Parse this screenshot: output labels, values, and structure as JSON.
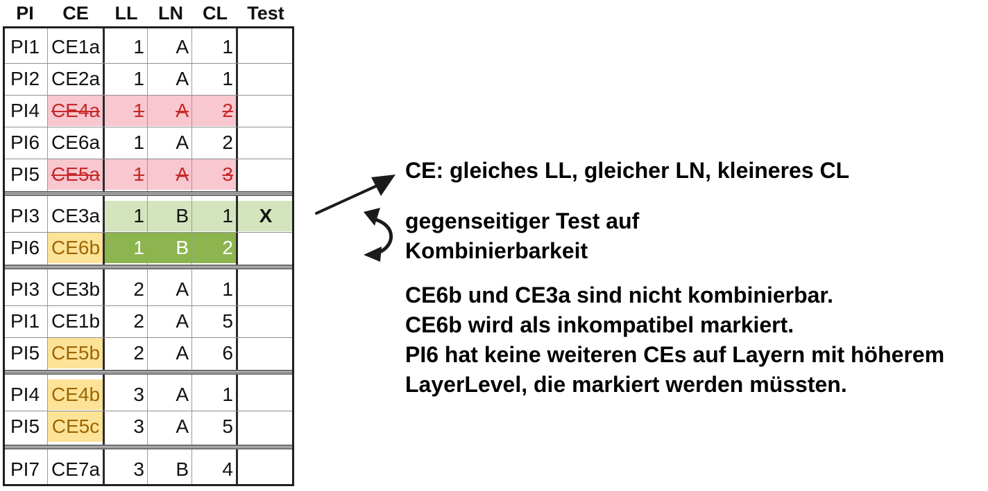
{
  "columns": [
    "PI",
    "CE",
    "LL",
    "LN",
    "CL",
    "Test"
  ],
  "rows": [
    {
      "pi": "PI1",
      "ce": "CE1a",
      "ll": "1",
      "ln": "A",
      "cl": "1",
      "test": "",
      "style": "normal"
    },
    {
      "pi": "PI2",
      "ce": "CE2a",
      "ll": "1",
      "ln": "A",
      "cl": "1",
      "test": "",
      "style": "normal"
    },
    {
      "pi": "PI4",
      "ce": "CE4a",
      "ll": "1",
      "ln": "A",
      "cl": "2",
      "test": "",
      "style": "struck"
    },
    {
      "pi": "PI6",
      "ce": "CE6a",
      "ll": "1",
      "ln": "A",
      "cl": "2",
      "test": "",
      "style": "normal"
    },
    {
      "pi": "PI5",
      "ce": "CE5a",
      "ll": "1",
      "ln": "A",
      "cl": "3",
      "test": "",
      "style": "struck"
    },
    {
      "pi": "PI3",
      "ce": "CE3a",
      "ll": "1",
      "ln": "B",
      "cl": "1",
      "test": "X",
      "style": "tested"
    },
    {
      "pi": "PI6",
      "ce": "CE6b",
      "ll": "1",
      "ln": "B",
      "cl": "2",
      "test": "",
      "style": "incompatible"
    },
    {
      "pi": "PI3",
      "ce": "CE3b",
      "ll": "2",
      "ln": "A",
      "cl": "1",
      "test": "",
      "style": "normal"
    },
    {
      "pi": "PI1",
      "ce": "CE1b",
      "ll": "2",
      "ln": "A",
      "cl": "5",
      "test": "",
      "style": "normal"
    },
    {
      "pi": "PI5",
      "ce": "CE5b",
      "ll": "2",
      "ln": "A",
      "cl": "6",
      "test": "",
      "style": "marked-ce"
    },
    {
      "pi": "PI4",
      "ce": "CE4b",
      "ll": "3",
      "ln": "A",
      "cl": "1",
      "test": "",
      "style": "marked-ce"
    },
    {
      "pi": "PI5",
      "ce": "CE5c",
      "ll": "3",
      "ln": "A",
      "cl": "5",
      "test": "",
      "style": "marked-ce"
    },
    {
      "pi": "PI7",
      "ce": "CE7a",
      "ll": "3",
      "ln": "B",
      "cl": "4",
      "test": "",
      "style": "normal"
    }
  ],
  "annotations": {
    "line1": "CE: gleiches LL, gleicher LN, kleineres CL",
    "line2a": "gegenseitiger Test auf",
    "line2b": "Kombinierbarkeit",
    "line3a": "CE6b und CE3a sind nicht kombinierbar.",
    "line3b": "CE6b wird als inkompatibel markiert.",
    "line3c": "PI6 hat keine weiteren CEs auf Layern mit höherem",
    "line3d": "LayerLevel, die markiert werden müssten."
  },
  "colors": {
    "struck_bg": "#f9c7cf",
    "struck_text": "#c62828",
    "tested_bg": "#d4e4bc",
    "incompatible_bg": "#8db54f",
    "marked_ce_bg": "#fde398",
    "marked_ce_text": "#9c6500"
  },
  "icons": [
    "arrow-right-up-icon",
    "circular-swap-arrow-icon"
  ]
}
